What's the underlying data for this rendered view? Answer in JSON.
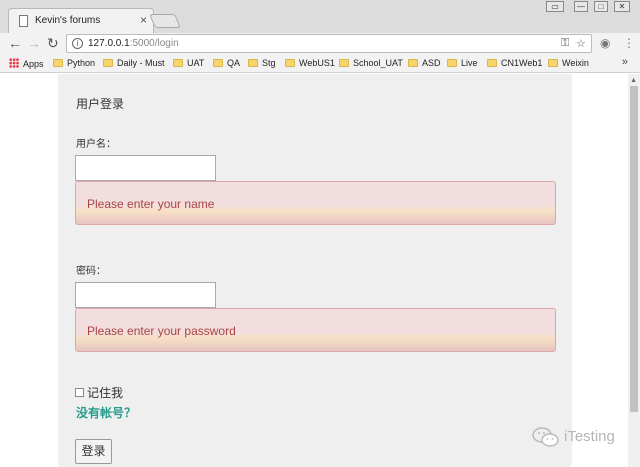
{
  "browser": {
    "tab_title": "Kevin's forums",
    "tab_close": "×",
    "window_controls": [
      "▭",
      "—",
      "□",
      "✕"
    ],
    "url_host": "127.0.0.1",
    "url_path": ":5000/login",
    "bookmarks": [
      "Apps",
      "Python",
      "Daily - Must",
      "UAT",
      "QA",
      "Stg",
      "WebUS1",
      "School_UAT",
      "ASD",
      "Live",
      "CN1Web1",
      "Weixin"
    ],
    "more": "»"
  },
  "form": {
    "heading": "用户登录",
    "username_label": "用户名：",
    "username_value": "",
    "username_error": "Please enter your name",
    "password_label": "密码：",
    "password_value": "",
    "password_error": "Please enter your password",
    "remember_label": "记住我",
    "register_link": "没有帐号？",
    "submit_label": "登录"
  },
  "watermark": {
    "text": "iTesting"
  },
  "colors": {
    "alert_text": "#a94442",
    "alert_bg": "#f2dede",
    "link": "#2a9d8f",
    "panel_bg": "#efefef"
  }
}
